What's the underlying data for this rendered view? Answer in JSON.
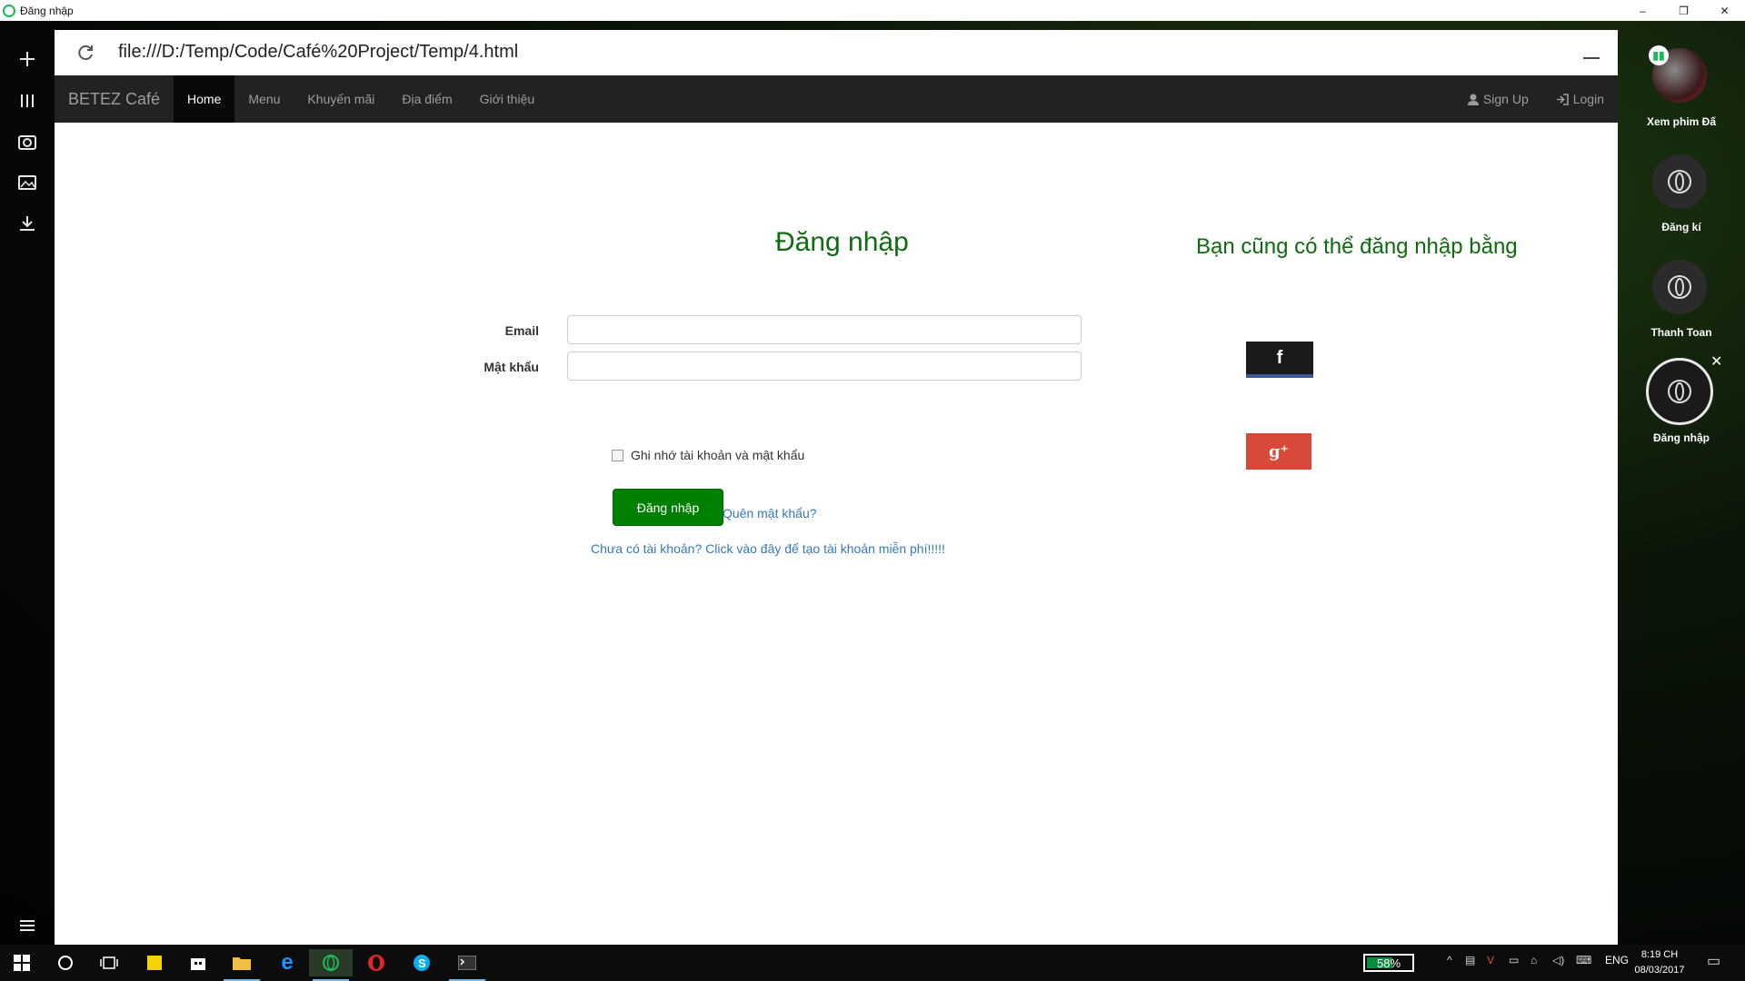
{
  "window": {
    "title": "Đăng nhập",
    "controls": [
      "–",
      "❐",
      "✕"
    ]
  },
  "left_sidebar": {
    "icons": [
      "plus-icon",
      "columns-icon",
      "camera-icon",
      "image-icon",
      "download-icon",
      "menu-icon"
    ]
  },
  "browser": {
    "url": "file:///D:/Temp/Code/Café%20Project/Temp/4.html"
  },
  "navbar": {
    "brand": "BETEZ Café",
    "items": [
      "Home",
      "Menu",
      "Khuyến mãi",
      "Địa điểm",
      "Giới thiệu"
    ],
    "active": "Home",
    "signup": "Sign Up",
    "login": "Login"
  },
  "form": {
    "title": "Đăng nhập",
    "email_label": "Email",
    "email_value": "",
    "password_label": "Mật khẩu",
    "password_value": "",
    "remember_label": "Ghi nhớ tài khoản và mật khẩu",
    "remember_checked": false,
    "submit_label": "Đăng nhập",
    "forgot_link": "Quên mật khẩu?",
    "register_link": "Chưa có tài khoản? Click vào đây để tạo tài khoản miễn phí!!!!!"
  },
  "social": {
    "title": "Bạn cũng có thể đăng nhập bằng",
    "facebook_glyph": "f",
    "google_glyph": "g⁺"
  },
  "right_sidebar": {
    "items": [
      {
        "label": "Xem phim Đấ"
      },
      {
        "label": "Đăng kí"
      },
      {
        "label": "Thanh Toan"
      },
      {
        "label": "Đăng nhập"
      }
    ]
  },
  "taskbar": {
    "battery": "58%",
    "battery_level": 0.58,
    "language": "ENG",
    "time": "8:19 CH",
    "date": "08/03/2017"
  },
  "colors": {
    "accent_green": "#008000",
    "title_green": "#0f6b0f",
    "navbar": "#222222",
    "link": "#337ab7",
    "facebook": "#3b5998",
    "google": "#d9493a"
  }
}
